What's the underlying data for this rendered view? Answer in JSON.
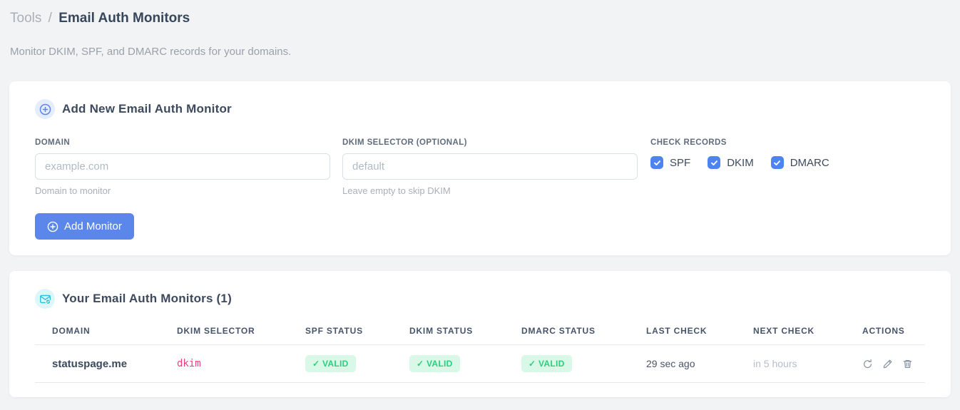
{
  "page": {
    "breadcrumb_parent": "Tools",
    "breadcrumb_separator": "/",
    "title": "Email Auth Monitors",
    "subtitle": "Monitor DKIM, SPF, and DMARC records for your domains."
  },
  "add_monitor_card": {
    "title": "Add New Email Auth Monitor",
    "domain_field": {
      "label": "DOMAIN",
      "placeholder": "example.com",
      "value": "",
      "hint": "Domain to monitor"
    },
    "dkim_selector_field": {
      "label": "DKIM SELECTOR (OPTIONAL)",
      "placeholder": "default",
      "value": "",
      "hint": "Leave empty to skip DKIM"
    },
    "check_records": {
      "label": "CHECK RECORDS",
      "options": [
        {
          "label": "SPF",
          "checked": true
        },
        {
          "label": "DKIM",
          "checked": true
        },
        {
          "label": "DMARC",
          "checked": true
        }
      ]
    },
    "submit_label": "Add Monitor"
  },
  "monitors_card": {
    "title": "Your Email Auth Monitors (1)",
    "table": {
      "columns": [
        "DOMAIN",
        "DKIM SELECTOR",
        "SPF STATUS",
        "DKIM STATUS",
        "DMARC STATUS",
        "LAST CHECK",
        "NEXT CHECK",
        "ACTIONS"
      ],
      "rows": [
        {
          "domain": "statuspage.me",
          "dkim_selector": "dkim",
          "spf_status": "✓ VALID",
          "dkim_status": "✓ VALID",
          "dmarc_status": "✓ VALID",
          "last_check": "29 sec ago",
          "next_check": "in 5 hours",
          "action_icons": [
            "refresh",
            "edit",
            "delete"
          ]
        }
      ]
    }
  },
  "colors": {
    "accent_blue": "#5b87ea",
    "checkbox_blue": "#4d84f1",
    "valid_badge_bg": "#d9f8e8",
    "valid_badge_text": "#29d07e",
    "selector_pink": "#ed3e7e",
    "icon_cyan": "#23c2d8"
  }
}
